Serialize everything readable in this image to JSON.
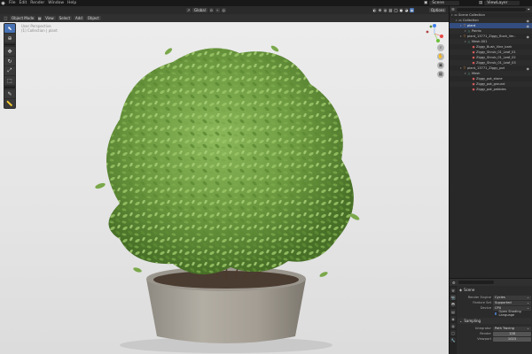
{
  "topbar": {
    "menu": [
      "File",
      "Edit",
      "Render",
      "Window",
      "Help"
    ],
    "scene_label": "Scene",
    "view_layer_label": "ViewLayer"
  },
  "viewport_header": {
    "mode": "Object Mode",
    "menus": [
      "View",
      "Select",
      "Add",
      "Object"
    ],
    "transform_orientation": "Global",
    "options_label": "Options"
  },
  "viewport": {
    "info_lines": [
      "User Perspective",
      "(1) Collection | plant"
    ]
  },
  "outliner": {
    "rows": [
      {
        "label": "Scene Collection",
        "indent": 0,
        "icon": "collection-icon",
        "selected": false,
        "eye": false
      },
      {
        "label": "Collection",
        "indent": 1,
        "icon": "collection-icon",
        "selected": false,
        "eye": true
      },
      {
        "label": "plant",
        "indent": 2,
        "icon": "object-icon",
        "selected": true,
        "eye": true
      },
      {
        "label": "Points",
        "indent": 3,
        "icon": "mesh-icon",
        "selected": false,
        "eye": false
      },
      {
        "label": "plant_13771_Ziggy_Bush_Ver..",
        "indent": 2,
        "icon": "object-icon",
        "selected": false,
        "eye": true
      },
      {
        "label": "Mesh.001",
        "indent": 3,
        "icon": "mesh-icon",
        "selected": false,
        "eye": false
      },
      {
        "label": "Ziggy_Bush_Vine_bark",
        "indent": 4,
        "icon": "material-icon",
        "selected": false,
        "eye": false
      },
      {
        "label": "Ziggy_Shrub_01_Leaf_01",
        "indent": 4,
        "icon": "material-icon",
        "selected": false,
        "eye": false
      },
      {
        "label": "Ziggy_Shrub_01_Leaf_02",
        "indent": 4,
        "icon": "material-icon",
        "selected": false,
        "eye": false
      },
      {
        "label": "Ziggy_Shrub_01_Leaf_03",
        "indent": 4,
        "icon": "material-icon",
        "selected": false,
        "eye": false
      },
      {
        "label": "plant_13771_Ziggy_pot",
        "indent": 2,
        "icon": "object-icon",
        "selected": false,
        "eye": true
      },
      {
        "label": "Mesh",
        "indent": 3,
        "icon": "mesh-icon",
        "selected": false,
        "eye": false
      },
      {
        "label": "Ziggy_pot_stone",
        "indent": 4,
        "icon": "material-icon",
        "selected": false,
        "eye": false
      },
      {
        "label": "Ziggy_pot_ground",
        "indent": 4,
        "icon": "material-icon",
        "selected": false,
        "eye": false
      },
      {
        "label": "Ziggy_pot_pebbles",
        "indent": 4,
        "icon": "material-icon",
        "selected": false,
        "eye": false
      }
    ]
  },
  "properties": {
    "title": "Scene",
    "render_engine_label": "Render Engine",
    "render_engine_value": "Cycles",
    "feature_set_label": "Feature Set",
    "feature_set_value": "Supported",
    "device_label": "Device",
    "device_value": "CPU",
    "osl_label": "Open Shading Language",
    "sampling_label": "Sampling",
    "integrator_label": "Integrator",
    "integrator_value": "Path Tracing",
    "render_label": "Render",
    "render_value": "128",
    "viewport_label": "Viewport",
    "viewport_value": "1023"
  },
  "colors": {
    "accent": "#4772b3",
    "selected_row": "#334d80",
    "panel_bg": "#282828",
    "viewport_bg": "#e8e8e8"
  }
}
